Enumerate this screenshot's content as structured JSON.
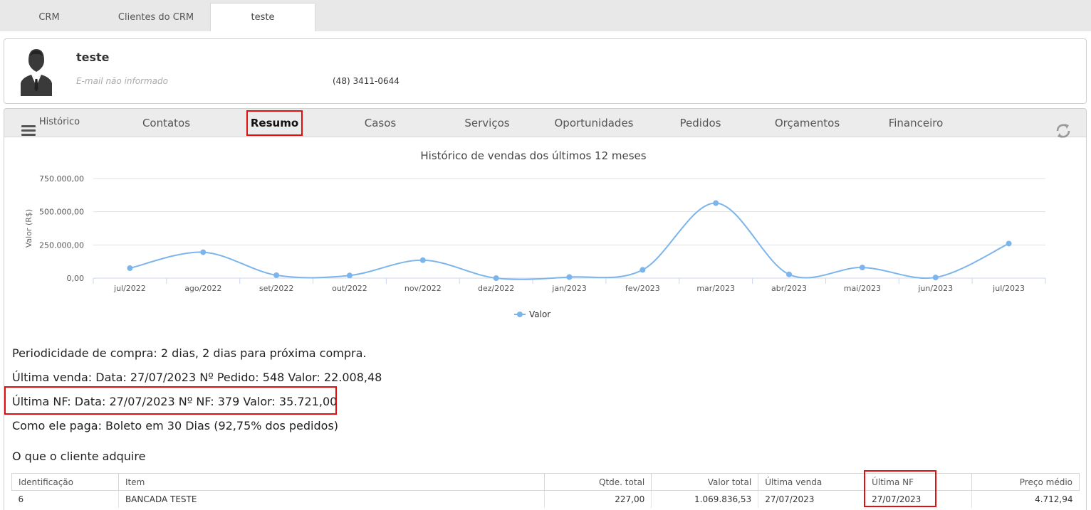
{
  "top_tabs": [
    "CRM",
    "Clientes do CRM",
    "teste"
  ],
  "profile": {
    "name": "teste",
    "email": "E-mail não informado",
    "phone": "(48) 3411-0644"
  },
  "subtabs": [
    "Histórico",
    "Contatos",
    "Resumo",
    "Casos",
    "Serviços",
    "Oportunidades",
    "Pedidos",
    "Orçamentos",
    "Financeiro"
  ],
  "active_subtab": "Resumo",
  "chart_data": {
    "type": "line",
    "title": "Histórico de vendas dos últimos 12 meses",
    "ylabel": "Valor (R$)",
    "xlabel": "",
    "categories": [
      "jul/2022",
      "ago/2022",
      "set/2022",
      "out/2022",
      "nov/2022",
      "dez/2022",
      "jan/2023",
      "fev/2023",
      "mar/2023",
      "abr/2023",
      "mai/2023",
      "jun/2023",
      "jul/2023"
    ],
    "y_ticks": [
      "0,00",
      "250.000,00",
      "500.000,00",
      "750.000,00"
    ],
    "ylim": [
      0,
      750000
    ],
    "series": [
      {
        "name": "Valor",
        "values": [
          75000,
          195000,
          22000,
          20000,
          135000,
          0,
          8000,
          62000,
          565000,
          28000,
          80000,
          5000,
          260000
        ]
      }
    ],
    "legend": "bottom-center",
    "line_color": "#7cb5ec",
    "grid": true
  },
  "summary": {
    "periodicidade": "Periodicidade de compra: 2 dias, 2 dias para próxima compra.",
    "ultima_venda": "Última venda: Data: 27/07/2023 Nº Pedido: 548 Valor: 22.008,48",
    "ultima_nf": "Última NF: Data: 27/07/2023 Nº NF: 379 Valor: 35.721,00",
    "como_paga": "Como ele paga: Boleto em 30 Dias (92,75% dos pedidos)",
    "section_title": "O que o cliente adquire"
  },
  "table": {
    "headers": [
      "Identificação",
      "Item",
      "Qtde. total",
      "Valor total",
      "Última venda",
      "Última NF",
      "Preço médio"
    ],
    "rows": [
      [
        "6",
        "BANCADA TESTE",
        "227,00",
        "1.069.836,53",
        "27/07/2023",
        "27/07/2023",
        "4.712,94"
      ]
    ]
  }
}
